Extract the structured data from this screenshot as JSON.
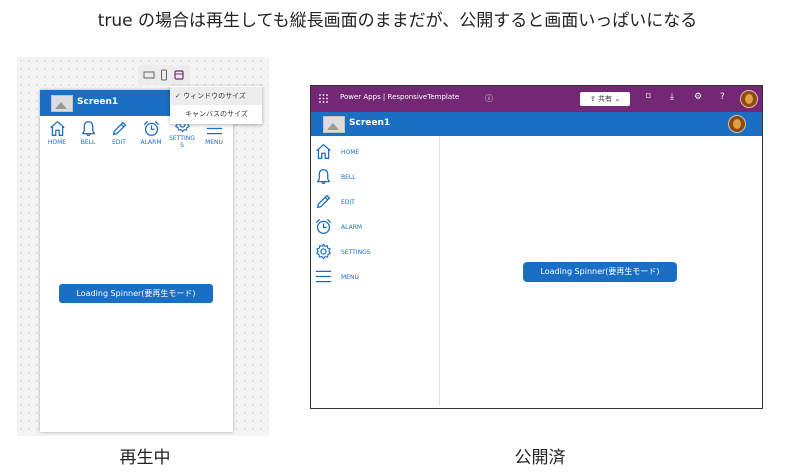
{
  "caption": "true の場合は再生しても縦長画面のままだが、公開すると画面いっぱいになる",
  "left_label": "再生中",
  "right_label": "公開済",
  "studio": {
    "screen_title": "Screen1",
    "icons": [
      {
        "label": "HOME",
        "icon": "home-icon"
      },
      {
        "label": "BELL",
        "icon": "bell-icon"
      },
      {
        "label": "EDIT",
        "icon": "edit-icon"
      },
      {
        "label": "ALARM",
        "icon": "alarm-icon"
      },
      {
        "label": "SETTING\nS",
        "icon": "settings-icon"
      },
      {
        "label": "MENU",
        "icon": "menu-icon"
      }
    ],
    "loading_button": "Loading Spinner(要再生モード)",
    "dropdown": {
      "options": [
        "ウィンドウのサイズ",
        "キャンバスのサイズ"
      ],
      "selected": "ウィンドウのサイズ"
    }
  },
  "published": {
    "app_title": "Power Apps | ResponsiveTemplate",
    "share_label": "共有",
    "screen_title": "Screen1",
    "menu": [
      {
        "label": "HOME",
        "icon": "home-icon"
      },
      {
        "label": "BELL",
        "icon": "bell-icon"
      },
      {
        "label": "EDIT",
        "icon": "edit-icon"
      },
      {
        "label": "ALARM",
        "icon": "alarm-icon"
      },
      {
        "label": "SETTINGS",
        "icon": "settings-icon"
      },
      {
        "label": "MENU",
        "icon": "menu-icon"
      }
    ],
    "loading_button": "Loading Spinner(要再生モード)"
  },
  "colors": {
    "brand_blue": "#1a6fc4",
    "power_apps_purple": "#742774"
  }
}
